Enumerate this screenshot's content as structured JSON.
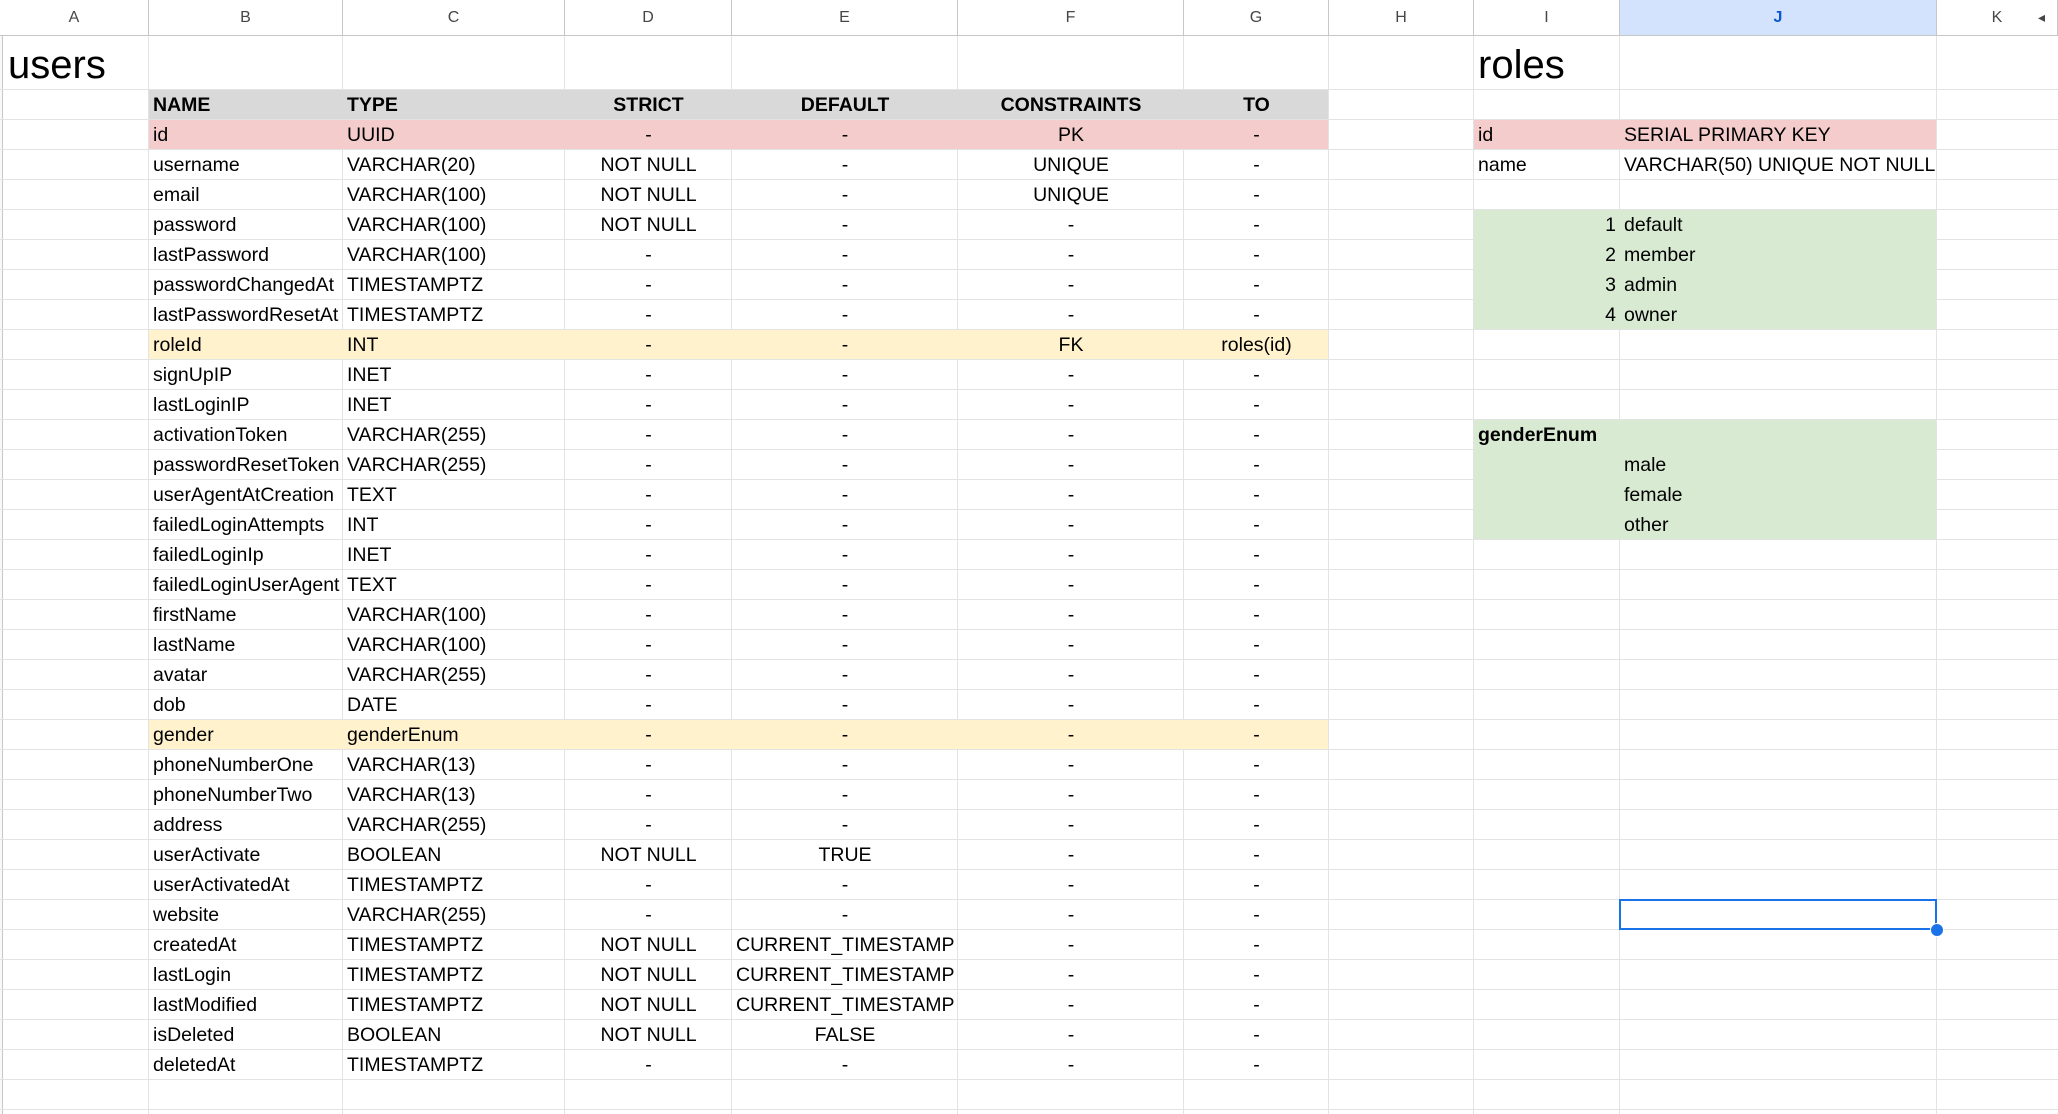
{
  "column_headers": [
    "A",
    "B",
    "C",
    "D",
    "E",
    "F",
    "G",
    "H",
    "I",
    "J",
    "K"
  ],
  "selected_column": "J",
  "colors": {
    "pk_row": "#f4cccc",
    "fk_row": "#fff2cc",
    "header_row": "#d9d9d9",
    "enum_fill": "#d9ead3",
    "selection": "#1a73e8",
    "gridline": "#e2e3e3"
  },
  "users": {
    "title": "users",
    "columns": [
      "NAME",
      "TYPE",
      "STRICT",
      "DEFAULT",
      "CONSTRAINTS",
      "TO"
    ],
    "rows": [
      {
        "name": "id",
        "type": "UUID",
        "strict": "-",
        "default": "-",
        "constraints": "PK",
        "to": "-",
        "highlight": "pk"
      },
      {
        "name": "username",
        "type": "VARCHAR(20)",
        "strict": "NOT NULL",
        "default": "-",
        "constraints": "UNIQUE",
        "to": "-"
      },
      {
        "name": "email",
        "type": "VARCHAR(100)",
        "strict": "NOT NULL",
        "default": "-",
        "constraints": "UNIQUE",
        "to": "-"
      },
      {
        "name": "password",
        "type": "VARCHAR(100)",
        "strict": "NOT NULL",
        "default": "-",
        "constraints": "-",
        "to": "-"
      },
      {
        "name": "lastPassword",
        "type": "VARCHAR(100)",
        "strict": "-",
        "default": "-",
        "constraints": "-",
        "to": "-"
      },
      {
        "name": "passwordChangedAt",
        "type": "TIMESTAMPTZ",
        "strict": "-",
        "default": "-",
        "constraints": "-",
        "to": "-"
      },
      {
        "name": "lastPasswordResetAt",
        "type": "TIMESTAMPTZ",
        "strict": "-",
        "default": "-",
        "constraints": "-",
        "to": "-"
      },
      {
        "name": "roleId",
        "type": "INT",
        "strict": "-",
        "default": "-",
        "constraints": "FK",
        "to": "roles(id)",
        "highlight": "fk"
      },
      {
        "name": "signUpIP",
        "type": "INET",
        "strict": "-",
        "default": "-",
        "constraints": "-",
        "to": "-"
      },
      {
        "name": "lastLoginIP",
        "type": "INET",
        "strict": "-",
        "default": "-",
        "constraints": "-",
        "to": "-"
      },
      {
        "name": "activationToken",
        "type": "VARCHAR(255)",
        "strict": "-",
        "default": "-",
        "constraints": "-",
        "to": "-"
      },
      {
        "name": "passwordResetToken",
        "type": "VARCHAR(255)",
        "strict": "-",
        "default": "-",
        "constraints": "-",
        "to": "-"
      },
      {
        "name": "userAgentAtCreation",
        "type": "TEXT",
        "strict": "-",
        "default": "-",
        "constraints": "-",
        "to": "-"
      },
      {
        "name": "failedLoginAttempts",
        "type": "INT",
        "strict": "-",
        "default": "-",
        "constraints": "-",
        "to": "-"
      },
      {
        "name": "failedLoginIp",
        "type": "INET",
        "strict": "-",
        "default": "-",
        "constraints": "-",
        "to": "-"
      },
      {
        "name": "failedLoginUserAgent",
        "type": "TEXT",
        "strict": "-",
        "default": "-",
        "constraints": "-",
        "to": "-"
      },
      {
        "name": "firstName",
        "type": "VARCHAR(100)",
        "strict": "-",
        "default": "-",
        "constraints": "-",
        "to": "-"
      },
      {
        "name": "lastName",
        "type": "VARCHAR(100)",
        "strict": "-",
        "default": "-",
        "constraints": "-",
        "to": "-"
      },
      {
        "name": "avatar",
        "type": "VARCHAR(255)",
        "strict": "-",
        "default": "-",
        "constraints": "-",
        "to": "-"
      },
      {
        "name": "dob",
        "type": "DATE",
        "strict": "-",
        "default": "-",
        "constraints": "-",
        "to": "-"
      },
      {
        "name": "gender",
        "type": "genderEnum",
        "strict": "-",
        "default": "-",
        "constraints": "-",
        "to": "-",
        "highlight": "fk"
      },
      {
        "name": "phoneNumberOne",
        "type": "VARCHAR(13)",
        "strict": "-",
        "default": "-",
        "constraints": "-",
        "to": "-"
      },
      {
        "name": "phoneNumberTwo",
        "type": "VARCHAR(13)",
        "strict": "-",
        "default": "-",
        "constraints": "-",
        "to": "-"
      },
      {
        "name": "address",
        "type": "VARCHAR(255)",
        "strict": "-",
        "default": "-",
        "constraints": "-",
        "to": "-"
      },
      {
        "name": "userActivate",
        "type": "BOOLEAN",
        "strict": "NOT NULL",
        "default": "TRUE",
        "constraints": "-",
        "to": "-"
      },
      {
        "name": "userActivatedAt",
        "type": "TIMESTAMPTZ",
        "strict": "-",
        "default": "-",
        "constraints": "-",
        "to": "-"
      },
      {
        "name": "website",
        "type": "VARCHAR(255)",
        "strict": "-",
        "default": "-",
        "constraints": "-",
        "to": "-"
      },
      {
        "name": "createdAt",
        "type": "TIMESTAMPTZ",
        "strict": "NOT NULL",
        "default": "CURRENT_TIMESTAMP",
        "constraints": "-",
        "to": "-"
      },
      {
        "name": "lastLogin",
        "type": "TIMESTAMPTZ",
        "strict": "NOT NULL",
        "default": "CURRENT_TIMESTAMP",
        "constraints": "-",
        "to": "-"
      },
      {
        "name": "lastModified",
        "type": "TIMESTAMPTZ",
        "strict": "NOT NULL",
        "default": "CURRENT_TIMESTAMP",
        "constraints": "-",
        "to": "-"
      },
      {
        "name": "isDeleted",
        "type": "BOOLEAN",
        "strict": "NOT NULL",
        "default": "FALSE",
        "constraints": "-",
        "to": "-"
      },
      {
        "name": "deletedAt",
        "type": "TIMESTAMPTZ",
        "strict": "-",
        "default": "-",
        "constraints": "-",
        "to": "-"
      }
    ]
  },
  "roles": {
    "title": "roles",
    "fields": [
      {
        "name": "id",
        "type": "SERIAL PRIMARY KEY",
        "highlight": "pk"
      },
      {
        "name": "name",
        "type": "VARCHAR(50) UNIQUE NOT NULL"
      }
    ],
    "values": [
      {
        "id": "1",
        "name": "default"
      },
      {
        "id": "2",
        "name": "member"
      },
      {
        "id": "3",
        "name": "admin"
      },
      {
        "id": "4",
        "name": "owner"
      }
    ]
  },
  "gender_enum": {
    "title": "genderEnum",
    "values": [
      "male",
      "female",
      "other"
    ]
  },
  "icons": {
    "collapse_arrow": "◂"
  }
}
